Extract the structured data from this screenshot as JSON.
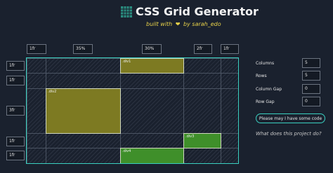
{
  "header": {
    "title": "CSS Grid Generator",
    "subtitle_prefix": "built with",
    "subtitle_suffix": "by sarah_edo",
    "heart_icon": "heart-icon",
    "logo_icon": "grid-logo-icon"
  },
  "columns": [
    "1fr",
    "35%",
    "30%",
    "2fr",
    "1fr"
  ],
  "rows": [
    "1fr",
    "1fr",
    "3fr",
    "1fr",
    "1fr"
  ],
  "items": [
    {
      "label": ".div1",
      "color": "#7d7a22"
    },
    {
      "label": ".div2",
      "color": "#7d7a22"
    },
    {
      "label": ".div3",
      "color": "#3f8f2a"
    },
    {
      "label": ".div4",
      "color": "#3f8f2a"
    }
  ],
  "settings": {
    "columns_label": "Columns",
    "columns_value": "5",
    "rows_label": "Rows",
    "rows_value": "5",
    "column_gap_label": "Column Gap",
    "column_gap_value": "0",
    "row_gap_label": "Row Gap",
    "row_gap_value": "0"
  },
  "actions": {
    "code_button": "Please may I have some code",
    "help_link": "What does this project do?"
  },
  "colors": {
    "accent": "#3ad0c1",
    "subtitle": "#e8d24a",
    "background": "#1a212e"
  }
}
